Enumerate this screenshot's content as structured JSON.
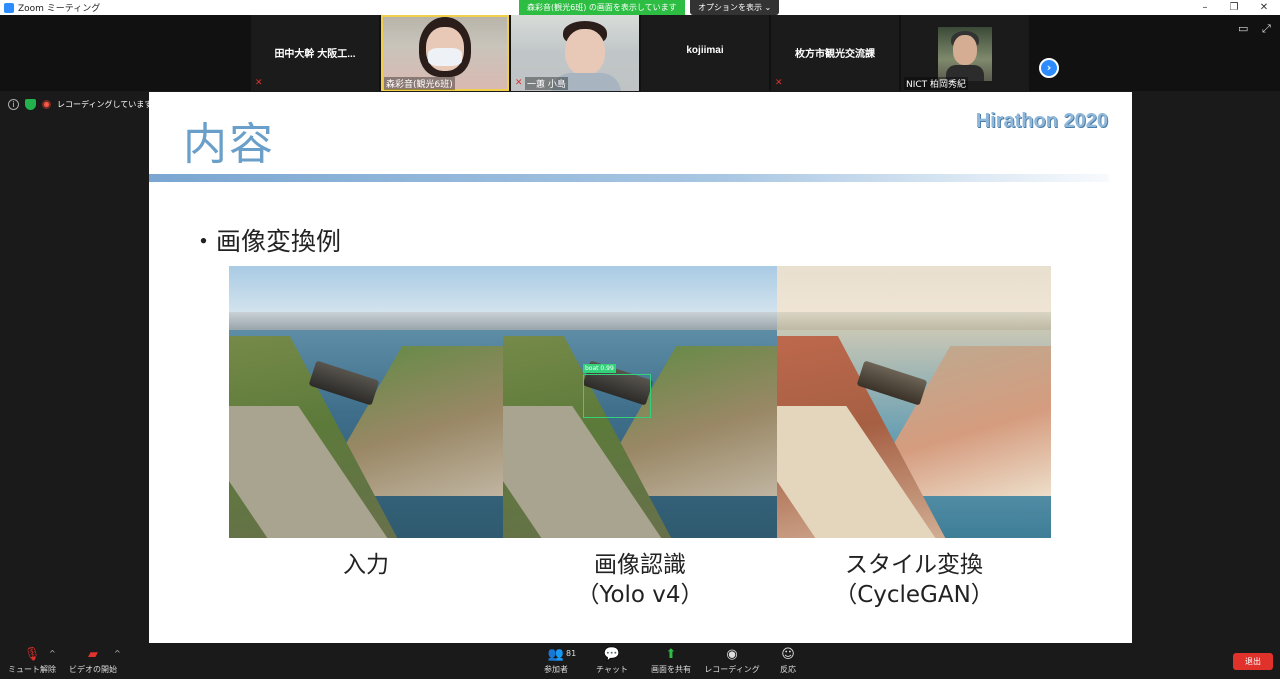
{
  "window": {
    "title": "Zoom ミーティング",
    "controls": [
      "–",
      "❐",
      "✕"
    ]
  },
  "share_banner": "森彩音(観光6班) の画面を表示しています",
  "options_banner": "オプションを表示 ⌄",
  "participants": [
    {
      "name": "田中大幹 大阪工...",
      "muted": true,
      "video": false
    },
    {
      "name": "森彩音(観光6班)",
      "muted": false,
      "video": true,
      "active": true
    },
    {
      "name": "一蕙 小島",
      "muted": true,
      "video": true
    },
    {
      "name": "kojiimai",
      "muted": false,
      "video": false
    },
    {
      "name": "枚方市観光交流課",
      "muted": true,
      "video": false
    },
    {
      "name": "NICT 柏岡秀紀",
      "muted": false,
      "video": true
    }
  ],
  "status": {
    "recording": "レコーディングしています"
  },
  "slide": {
    "title": "内容",
    "brand": "Hirathon 2020",
    "bullet": "・画像変換例",
    "detection_label": "boat 0.99",
    "captions": [
      {
        "line1": "入力",
        "line2": ""
      },
      {
        "line1": "画像認識",
        "line2": "（Yolo v4）"
      },
      {
        "line1": "スタイル変換",
        "line2": "（CycleGAN）"
      }
    ]
  },
  "toolbar": {
    "mute": "ミュート解除",
    "video": "ビデオの開始",
    "participants": "参加者",
    "participants_count": "81",
    "chat": "チャット",
    "share": "画面を共有",
    "record": "レコーディング",
    "reactions": "反応",
    "leave": "退出"
  }
}
